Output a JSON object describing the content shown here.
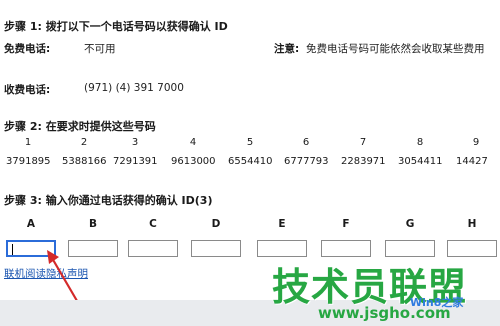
{
  "step1": {
    "title": "步骤 1: 拨打以下一个电话号码以获得确认 ID",
    "free_label": "免费电话:",
    "free_value": "不可用",
    "note_label": "注意:",
    "note_text": "免费电话号码可能依然会收取某些费用",
    "paid_label": "收费电话:",
    "paid_value": "(971) (4) 391 7000"
  },
  "step2": {
    "title": "步骤 2: 在要求时提供这些号码",
    "groups": [
      {
        "index": "1",
        "code": "3791895"
      },
      {
        "index": "2",
        "code": "5388166"
      },
      {
        "index": "3",
        "code": "7291391"
      },
      {
        "index": "4",
        "code": "9613000"
      },
      {
        "index": "5",
        "code": "6554410"
      },
      {
        "index": "6",
        "code": "6777793"
      },
      {
        "index": "7",
        "code": "2283971"
      },
      {
        "index": "8",
        "code": "3054411"
      },
      {
        "index": "9",
        "code": "14427"
      }
    ]
  },
  "step3": {
    "title": "步骤 3: 输入你通过电话获得的确认 ID(3)",
    "columns": [
      "A",
      "B",
      "C",
      "D",
      "E",
      "F",
      "G",
      "H"
    ],
    "inputs": [
      "",
      "",
      "",
      "",
      "",
      "",
      "",
      ""
    ]
  },
  "privacy_link": "联机阅读隐私声明",
  "watermark": {
    "main": "技术员联盟",
    "sub": "Win8之家",
    "url": "www.jsgho.com"
  },
  "colors": {
    "link": "#1a55b0",
    "active_input": "#2b6cd9",
    "arrow": "#d42a2a",
    "watermark": "#27a743"
  }
}
